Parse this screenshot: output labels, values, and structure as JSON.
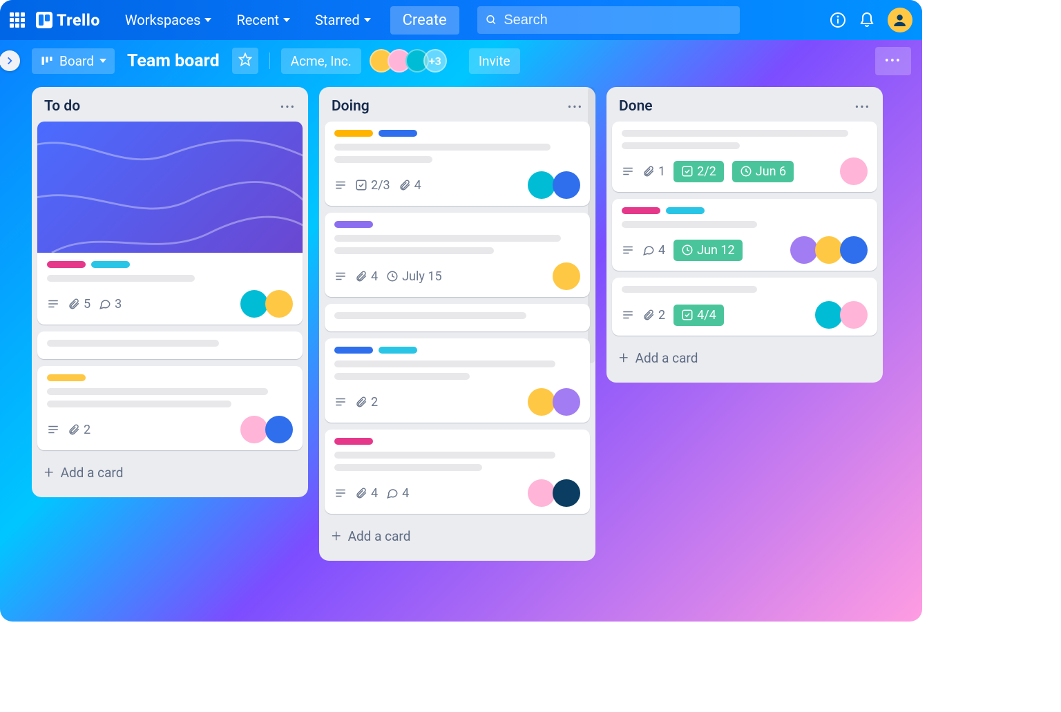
{
  "brand": "Trello",
  "nav": {
    "workspaces": "Workspaces",
    "recent": "Recent",
    "starred": "Starred",
    "create": "Create"
  },
  "search": {
    "placeholder": "Search"
  },
  "board": {
    "view_label": "Board",
    "title": "Team board",
    "org": "Acme, Inc.",
    "more_members": "+3",
    "invite": "Invite"
  },
  "lists": [
    {
      "title": "To do",
      "add_label": "Add a card",
      "cards": [
        {
          "cover": true,
          "labels": [
            "#e6388b",
            "#29c5e6"
          ],
          "badges": {
            "attach": "5",
            "comments": "3"
          },
          "members": [
            "teal",
            "yellow"
          ]
        },
        {
          "plain": true
        },
        {
          "labels": [
            "#ffc844"
          ],
          "badges": {
            "attach": "2"
          },
          "members": [
            "pink",
            "blue"
          ]
        }
      ]
    },
    {
      "title": "Doing",
      "add_label": "Add a card",
      "cards": [
        {
          "labels": [
            "#ffb400",
            "#2f6fed"
          ],
          "badges": {
            "check": "2/3",
            "attach": "4"
          },
          "members": [
            "teal",
            "blue"
          ]
        },
        {
          "labels": [
            "#8c6ff0"
          ],
          "badges": {
            "attach": "4",
            "due": "July 15"
          },
          "members": [
            "yellow"
          ]
        },
        {
          "plain": true
        },
        {
          "labels": [
            "#2f6fed",
            "#29c5e6"
          ],
          "badges": {
            "attach": "2"
          },
          "members": [
            "yellow",
            "purple"
          ]
        },
        {
          "labels": [
            "#e6388b"
          ],
          "badges": {
            "attach": "4",
            "comments": "4"
          },
          "members": [
            "pink",
            "dark"
          ]
        }
      ]
    },
    {
      "title": "Done",
      "add_label": "Add a card",
      "cards": [
        {
          "badges": {
            "attach": "1",
            "check_done": "2/2",
            "due_done": "Jun 6"
          },
          "members": [
            "pink"
          ]
        },
        {
          "labels": [
            "#e6388b",
            "#29c5e6"
          ],
          "badges": {
            "comments": "4",
            "due_done": "Jun 12"
          },
          "members": [
            "purple",
            "yellow",
            "blue"
          ]
        },
        {
          "badges": {
            "attach": "2",
            "check_done": "4/4"
          },
          "members": [
            "teal",
            "pink"
          ]
        }
      ]
    }
  ]
}
